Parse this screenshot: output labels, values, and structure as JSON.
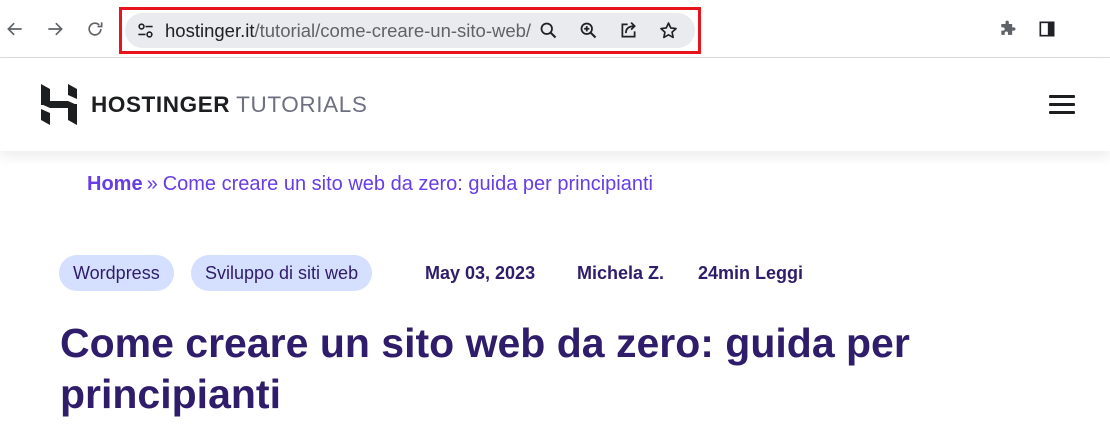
{
  "browser": {
    "url_host": "hostinger.it",
    "url_path": "/tutorial/come-creare-un-sito-web/",
    "icons": {
      "back": "arrow-left-icon",
      "forward": "arrow-right-icon",
      "reload": "reload-icon",
      "site_info": "tune-icon",
      "search": "search-icon",
      "zoom": "zoom-in-icon",
      "share": "share-icon",
      "bookmark": "star-icon",
      "extensions": "puzzle-icon",
      "side_panel": "side-panel-icon"
    },
    "highlight_color": "#e8141b"
  },
  "site": {
    "brand": "HOSTINGER",
    "suffix": "TUTORIALS",
    "menu_icon": "hamburger-menu-icon"
  },
  "breadcrumb": {
    "home": "Home",
    "separator": "»",
    "current": "Come creare un sito web da zero: guida per principianti"
  },
  "article": {
    "tags": [
      "Wordpress",
      "Sviluppo di siti web"
    ],
    "date": "May 03, 2023",
    "author": "Michela Z.",
    "read_time": "24min Leggi",
    "title": "Come creare un sito web da zero: guida per principianti"
  },
  "colors": {
    "accent": "#673de6",
    "heading": "#2f1c6a",
    "tag_bg": "#d5dfff"
  }
}
